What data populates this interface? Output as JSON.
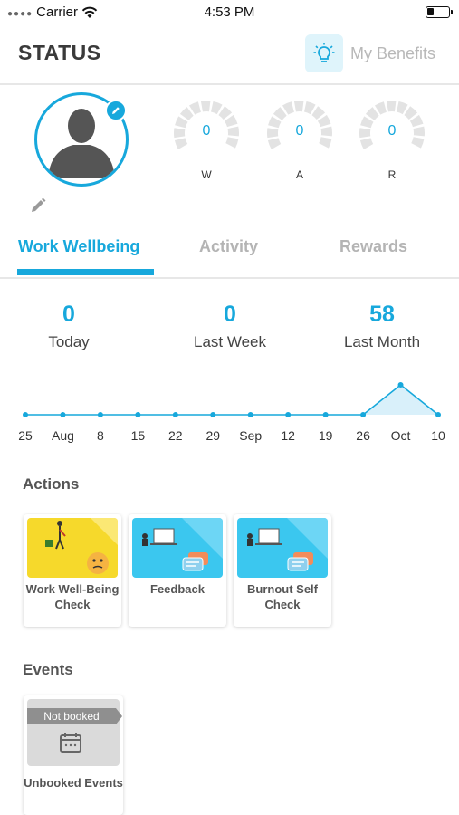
{
  "status_bar": {
    "carrier": "Carrier",
    "time": "4:53 PM"
  },
  "header": {
    "title": "STATUS",
    "benefits_label": "My Benefits"
  },
  "profile": {
    "gauges": [
      {
        "value": "0",
        "label": "W"
      },
      {
        "value": "0",
        "label": "A"
      },
      {
        "value": "0",
        "label": "R"
      }
    ]
  },
  "tabs": [
    {
      "label": "Work Wellbeing",
      "active": true
    },
    {
      "label": "Activity",
      "active": false
    },
    {
      "label": "Rewards",
      "active": false
    }
  ],
  "stats": [
    {
      "value": "0",
      "label": "Today"
    },
    {
      "value": "0",
      "label": "Last Week"
    },
    {
      "value": "58",
      "label": "Last Month"
    }
  ],
  "chart_data": {
    "type": "line",
    "x": [
      "25",
      "Aug",
      "8",
      "15",
      "22",
      "29",
      "Sep",
      "12",
      "19",
      "26",
      "Oct",
      "10"
    ],
    "values": [
      0,
      0,
      0,
      0,
      0,
      0,
      0,
      0,
      0,
      0,
      58,
      0
    ],
    "color": "#17a8dc"
  },
  "actions": {
    "title": "Actions",
    "items": [
      {
        "label": "Work Well-Being Check"
      },
      {
        "label": "Feedback"
      },
      {
        "label": "Burnout Self Check"
      }
    ]
  },
  "events": {
    "title": "Events",
    "items": [
      {
        "badge": "Not booked",
        "label": "Unbooked Events"
      }
    ]
  },
  "colors": {
    "accent": "#17a8dc",
    "yellow_card": "#f6d92b",
    "blue_card": "#3bc7ef"
  }
}
